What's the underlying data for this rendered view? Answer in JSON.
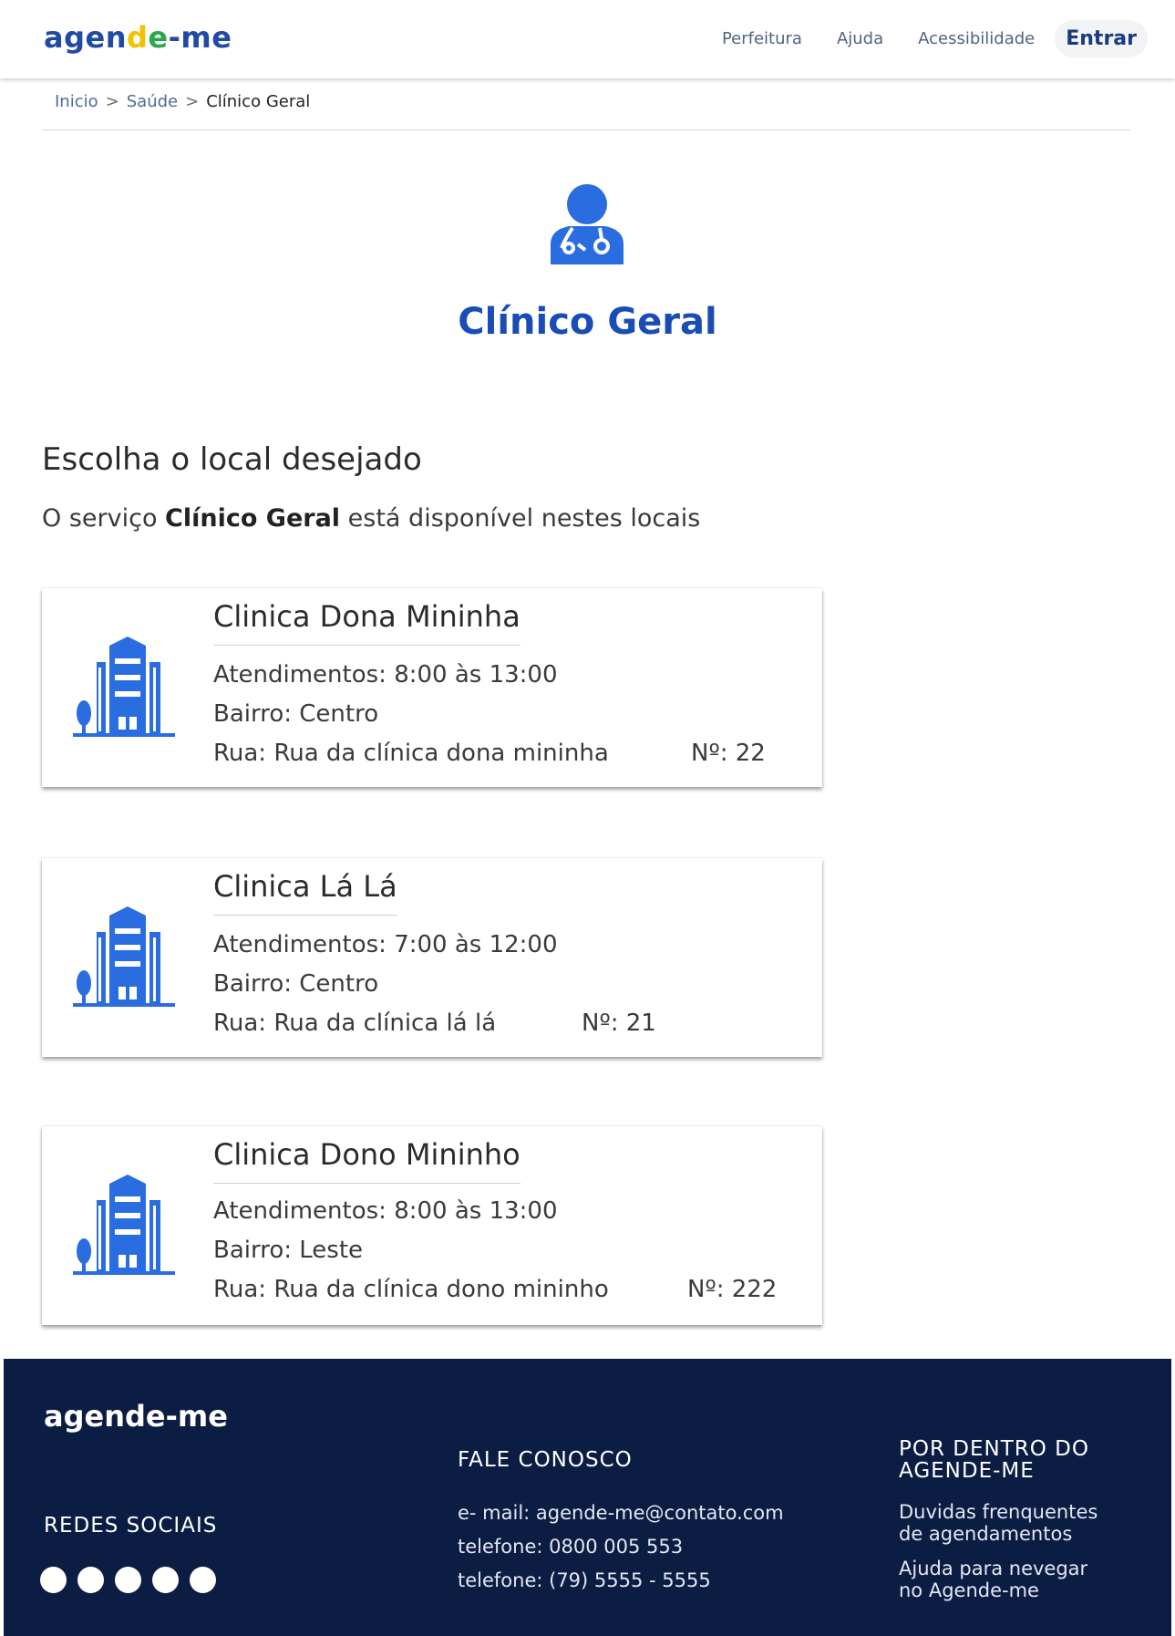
{
  "header": {
    "logo": {
      "part1": "agen",
      "part2": "d",
      "part3": "e",
      "part4": "-me"
    },
    "nav": [
      "Perfeitura",
      "Ajuda",
      "Acessibilidade"
    ],
    "login_label": "Entrar"
  },
  "breadcrumb": {
    "items": [
      "Inicio",
      "Saúde"
    ],
    "current": "Clínico Geral",
    "separator": ">"
  },
  "service": {
    "icon": "doctor-icon",
    "title": "Clínico Geral"
  },
  "section": {
    "title": "Escolha o local desejado",
    "sub_before": "O serviço ",
    "sub_bold": "Clínico Geral",
    "sub_after": " está disponível nestes locais"
  },
  "clinics": [
    {
      "name": "Clinica Dona Mininha",
      "hours": "Atendimentos: 8:00 às 13:00",
      "district": "Bairro: Centro",
      "street": "Rua: Rua da clínica dona mininha",
      "number": "Nº: 22"
    },
    {
      "name": "Clinica Lá Lá",
      "hours": "Atendimentos: 7:00 às 12:00",
      "district": "Bairro: Centro",
      "street": "Rua: Rua da clínica lá lá",
      "number": "Nº: 21"
    },
    {
      "name": "Clinica Dono Mininho",
      "hours": "Atendimentos: 8:00 às 13:00",
      "district": "Bairro: Leste",
      "street": "Rua: Rua da clínica dono mininho",
      "number": "Nº: 222"
    }
  ],
  "footer": {
    "logo": "agende-me",
    "social_title": "REDES SOCIAIS",
    "contact_title": "FALE CONOSCO",
    "contact": [
      "e- mail: agende-me@contato.com",
      "telefone: 0800 005 553",
      "telefone: (79) 5555 - 5555"
    ],
    "about_title_1": "POR DENTRO DO",
    "about_title_2": "AGENDE-ME",
    "about_links": [
      {
        "line1": "Duvidas frenquentes",
        "line2": "de agendamentos"
      },
      {
        "line1": "Ajuda para nevegar",
        "line2": "no Agende-me"
      }
    ]
  },
  "colors": {
    "primary": "#1a4cb5",
    "icon_blue": "#2a6de0",
    "footer_bg": "#0c1d44"
  }
}
